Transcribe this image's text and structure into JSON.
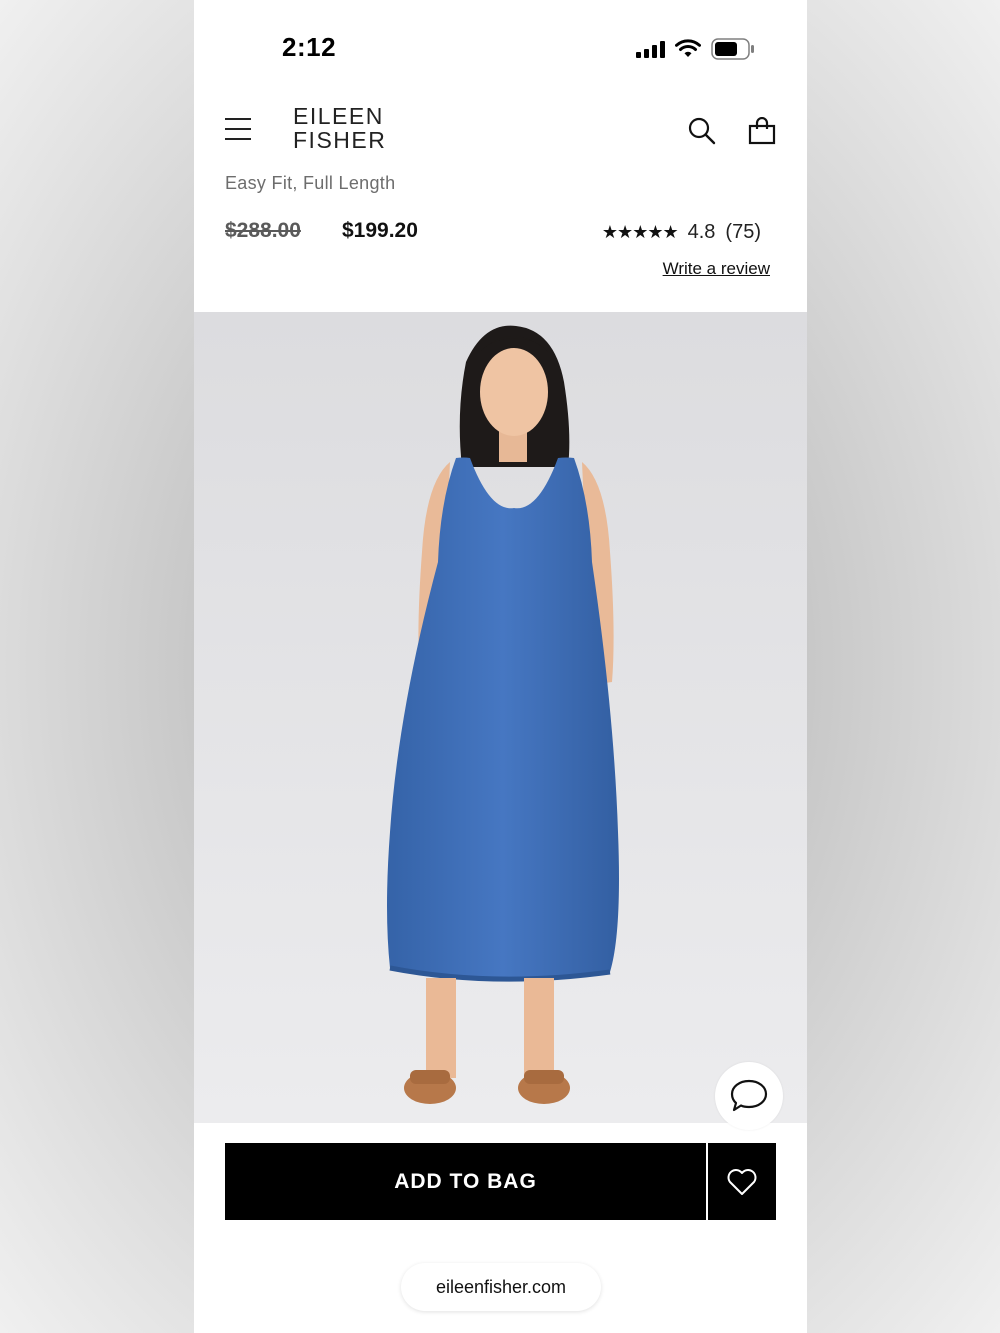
{
  "status_bar": {
    "time": "2:12",
    "icons": [
      "signal-icon",
      "wifi-icon",
      "battery-icon"
    ]
  },
  "header": {
    "brand_line1": "EILEEN",
    "brand_line2": "FISHER",
    "icons": [
      "hamburger-menu-icon",
      "search-icon",
      "shopping-bag-icon"
    ]
  },
  "product": {
    "subtitle": "Easy Fit, Full Length",
    "original_price": "$288.00",
    "sale_price": "$199.20",
    "stars": "★★★★★",
    "rating_value": "4.8",
    "review_count": "(75)",
    "write_review_label": "Write a review",
    "dress_color": "#3f6fb8"
  },
  "actions": {
    "add_to_bag_label": "ADD TO BAG",
    "wishlist_icon": "heart-icon",
    "chat_icon": "chat-bubble-icon"
  },
  "browser": {
    "url": "eileenfisher.com"
  },
  "colors": {
    "primary_button": "#000000",
    "image_background": "#e4e4e6"
  }
}
